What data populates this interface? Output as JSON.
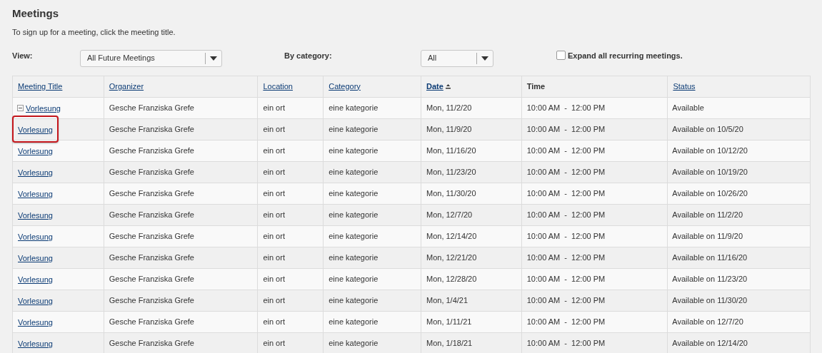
{
  "title": "Meetings",
  "instructions": "To sign up for a meeting, click the meeting title.",
  "filters": {
    "view_label": "View:",
    "view_value": "All Future Meetings",
    "category_label": "By category:",
    "category_value": "All",
    "expand_label": "Expand all recurring meetings.",
    "expand_checked": false
  },
  "columns": [
    {
      "label": "Meeting Title",
      "kind": "link",
      "sorted": false
    },
    {
      "label": "Organizer",
      "kind": "link",
      "sorted": false
    },
    {
      "label": "Location",
      "kind": "link",
      "sorted": false
    },
    {
      "label": "Category",
      "kind": "link",
      "sorted": false
    },
    {
      "label": "Date",
      "kind": "link",
      "sorted": true
    },
    {
      "label": "Time",
      "kind": "plain",
      "sorted": false
    },
    {
      "label": "Status",
      "kind": "link",
      "sorted": false
    }
  ],
  "rows": [
    {
      "kind": "series",
      "highlighted": false,
      "title": "Vorlesung",
      "organizer": "Gesche Franziska Grefe",
      "location": "ein ort",
      "category": "eine kategorie",
      "date": "Mon, 11/2/20",
      "time": "10:00 AM  -  12:00 PM",
      "status": "Available"
    },
    {
      "kind": "occurrence",
      "highlighted": true,
      "title": "Vorlesung",
      "organizer": "Gesche Franziska Grefe",
      "location": "ein ort",
      "category": "eine kategorie",
      "date": "Mon, 11/9/20",
      "time": "10:00 AM  -  12:00 PM",
      "status": "Available on 10/5/20"
    },
    {
      "kind": "occurrence",
      "highlighted": false,
      "title": "Vorlesung",
      "organizer": "Gesche Franziska Grefe",
      "location": "ein ort",
      "category": "eine kategorie",
      "date": "Mon, 11/16/20",
      "time": "10:00 AM  -  12:00 PM",
      "status": "Available on 10/12/20"
    },
    {
      "kind": "occurrence",
      "highlighted": false,
      "title": "Vorlesung",
      "organizer": "Gesche Franziska Grefe",
      "location": "ein ort",
      "category": "eine kategorie",
      "date": "Mon, 11/23/20",
      "time": "10:00 AM  -  12:00 PM",
      "status": "Available on 10/19/20"
    },
    {
      "kind": "occurrence",
      "highlighted": false,
      "title": "Vorlesung",
      "organizer": "Gesche Franziska Grefe",
      "location": "ein ort",
      "category": "eine kategorie",
      "date": "Mon, 11/30/20",
      "time": "10:00 AM  -  12:00 PM",
      "status": "Available on 10/26/20"
    },
    {
      "kind": "occurrence",
      "highlighted": false,
      "title": "Vorlesung",
      "organizer": "Gesche Franziska Grefe",
      "location": "ein ort",
      "category": "eine kategorie",
      "date": "Mon, 12/7/20",
      "time": "10:00 AM  -  12:00 PM",
      "status": "Available on 11/2/20"
    },
    {
      "kind": "occurrence",
      "highlighted": false,
      "title": "Vorlesung",
      "organizer": "Gesche Franziska Grefe",
      "location": "ein ort",
      "category": "eine kategorie",
      "date": "Mon, 12/14/20",
      "time": "10:00 AM  -  12:00 PM",
      "status": "Available on 11/9/20"
    },
    {
      "kind": "occurrence",
      "highlighted": false,
      "title": "Vorlesung",
      "organizer": "Gesche Franziska Grefe",
      "location": "ein ort",
      "category": "eine kategorie",
      "date": "Mon, 12/21/20",
      "time": "10:00 AM  -  12:00 PM",
      "status": "Available on 11/16/20"
    },
    {
      "kind": "occurrence",
      "highlighted": false,
      "title": "Vorlesung",
      "organizer": "Gesche Franziska Grefe",
      "location": "ein ort",
      "category": "eine kategorie",
      "date": "Mon, 12/28/20",
      "time": "10:00 AM  -  12:00 PM",
      "status": "Available on 11/23/20"
    },
    {
      "kind": "occurrence",
      "highlighted": false,
      "title": "Vorlesung",
      "organizer": "Gesche Franziska Grefe",
      "location": "ein ort",
      "category": "eine kategorie",
      "date": "Mon, 1/4/21",
      "time": "10:00 AM  -  12:00 PM",
      "status": "Available on 11/30/20"
    },
    {
      "kind": "occurrence",
      "highlighted": false,
      "title": "Vorlesung",
      "organizer": "Gesche Franziska Grefe",
      "location": "ein ort",
      "category": "eine kategorie",
      "date": "Mon, 1/11/21",
      "time": "10:00 AM  -  12:00 PM",
      "status": "Available on 12/7/20"
    },
    {
      "kind": "occurrence",
      "highlighted": false,
      "title": "Vorlesung",
      "organizer": "Gesche Franziska Grefe",
      "location": "ein ort",
      "category": "eine kategorie",
      "date": "Mon, 1/18/21",
      "time": "10:00 AM  -  12:00 PM",
      "status": "Available on 12/14/20"
    }
  ]
}
